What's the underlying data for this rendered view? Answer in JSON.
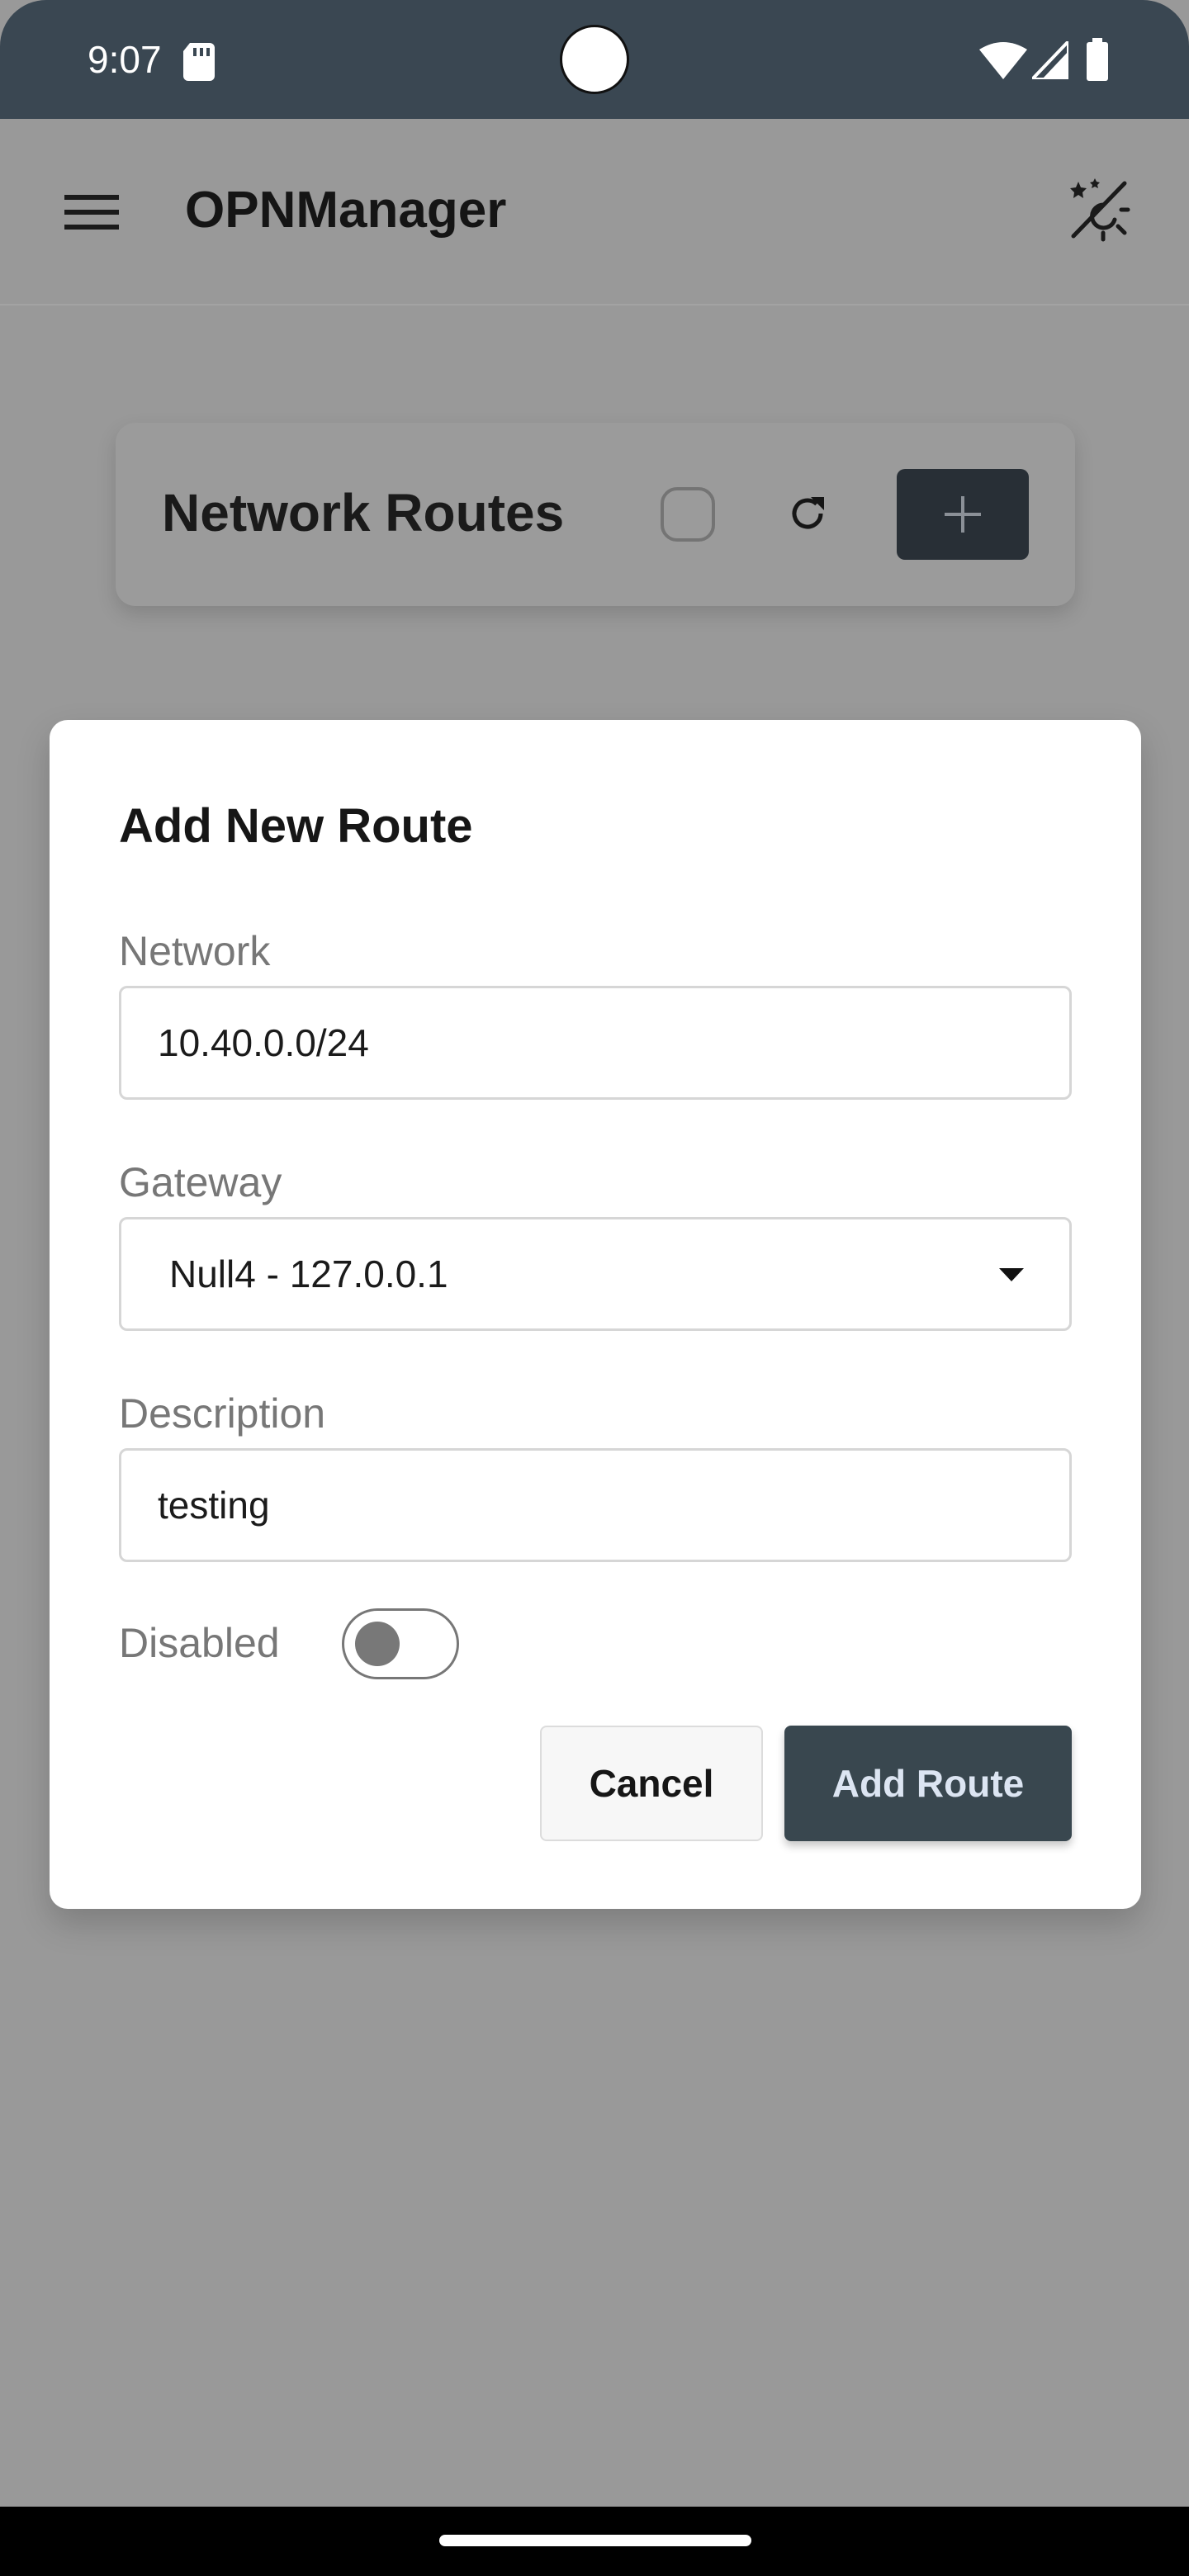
{
  "status_bar": {
    "time": "9:07"
  },
  "app_bar": {
    "title": "OPNManager",
    "menu_icon": "hamburger-menu-icon",
    "theme_icon": "theme-toggle-icon"
  },
  "page": {
    "title": "Network Routes",
    "refresh_icon": "refresh-icon",
    "add_icon": "plus-icon"
  },
  "dialog": {
    "title": "Add New Route",
    "network": {
      "label": "Network",
      "value": "10.40.0.0/24"
    },
    "gateway": {
      "label": "Gateway",
      "selected": "Null4 - 127.0.0.1"
    },
    "description": {
      "label": "Description",
      "value": "testing"
    },
    "disabled": {
      "label": "Disabled",
      "on": false
    },
    "cancel_label": "Cancel",
    "submit_label": "Add Route"
  },
  "colors": {
    "status_bar_bg": "#3a4752",
    "scrim_bg": "#999999",
    "primary_button_bg": "#39474f",
    "primary_button_text": "#dce5f2"
  }
}
